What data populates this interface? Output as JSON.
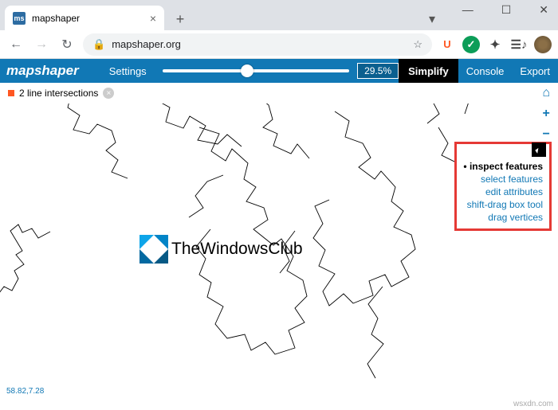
{
  "window": {
    "title": "mapshaper"
  },
  "browser": {
    "url_display": "mapshaper.org",
    "new_tab": "+",
    "back": "←",
    "forward": "→",
    "reload": "↻",
    "lock": "🔒",
    "star": "☆",
    "ext_u": "U",
    "ext_g": "✓",
    "tab_menu": "▾"
  },
  "toolbar": {
    "logo": "mapshaper",
    "settings": "Settings",
    "percent": "29.5%",
    "simplify": "Simplify",
    "console": "Console",
    "export": "Export"
  },
  "status": {
    "intersections": "2 line intersections",
    "dismiss": "×"
  },
  "side": {
    "home": "⌂",
    "zoom_in": "+",
    "zoom_out": "−"
  },
  "context": {
    "inspect": "inspect features",
    "select": "select features",
    "edit": "edit attributes",
    "box": "shift-drag box tool",
    "drag": "drag vertices"
  },
  "center_logo": "TheWindowsClub",
  "coords": "58.82,7.28",
  "credit": "wsxdn.com"
}
